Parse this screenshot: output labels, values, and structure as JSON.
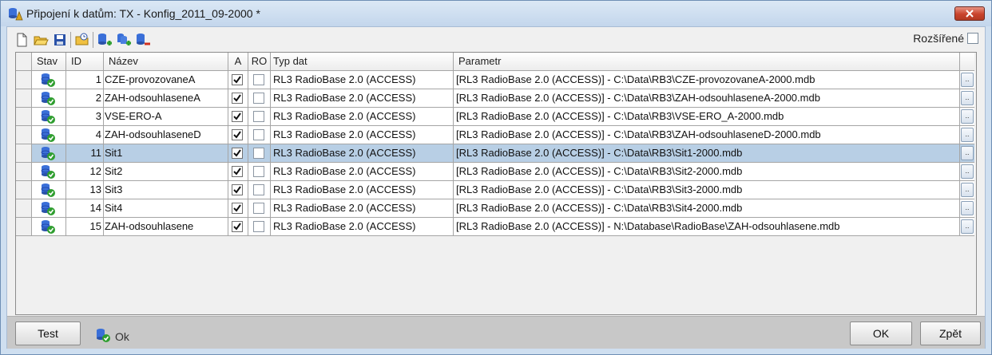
{
  "window": {
    "title": "Připojení k datům: TX - Konfig_2011_09-2000 *",
    "close_icon": "close-icon"
  },
  "toolbar": {
    "icons": [
      "new-document-icon",
      "open-folder-icon",
      "save-icon",
      "open-recent-icon",
      "add-database-icon",
      "add-databases-icon",
      "remove-database-icon"
    ],
    "rozsirene_label": "Rozšířené",
    "rozsirene_checked": false
  },
  "table": {
    "columns": {
      "stav": "Stav",
      "id": "ID",
      "nazev": "Název",
      "a": "A",
      "ro": "RO",
      "typ": "Typ dat",
      "parametr": "Parametr"
    },
    "rows": [
      {
        "id": "1",
        "nazev": "CZE-provozovaneA",
        "a": true,
        "ro": false,
        "typ": "RL3 RadioBase 2.0 (ACCESS)",
        "parametr": "[RL3 RadioBase 2.0 (ACCESS)] - C:\\Data\\RB3\\CZE-provozovaneA-2000.mdb",
        "btn": "..",
        "selected": false
      },
      {
        "id": "2",
        "nazev": "ZAH-odsouhlaseneA",
        "a": true,
        "ro": false,
        "typ": "RL3 RadioBase 2.0 (ACCESS)",
        "parametr": "[RL3 RadioBase 2.0 (ACCESS)] - C:\\Data\\RB3\\ZAH-odsouhlaseneA-2000.mdb",
        "btn": "..",
        "selected": false
      },
      {
        "id": "3",
        "nazev": "VSE-ERO-A",
        "a": true,
        "ro": false,
        "typ": "RL3 RadioBase 2.0 (ACCESS)",
        "parametr": "[RL3 RadioBase 2.0 (ACCESS)] - C:\\Data\\RB3\\VSE-ERO_A-2000.mdb",
        "btn": "..",
        "selected": false
      },
      {
        "id": "4",
        "nazev": "ZAH-odsouhlaseneD",
        "a": true,
        "ro": false,
        "typ": "RL3 RadioBase 2.0 (ACCESS)",
        "parametr": "[RL3 RadioBase 2.0 (ACCESS)] - C:\\Data\\RB3\\ZAH-odsouhlaseneD-2000.mdb",
        "btn": "..",
        "selected": false
      },
      {
        "id": "11",
        "nazev": "Sit1",
        "a": true,
        "ro": false,
        "typ": "RL3 RadioBase 2.0 (ACCESS)",
        "parametr": "[RL3 RadioBase 2.0 (ACCESS)] - C:\\Data\\RB3\\Sit1-2000.mdb",
        "btn": "..",
        "selected": true
      },
      {
        "id": "12",
        "nazev": "Sit2",
        "a": true,
        "ro": false,
        "typ": "RL3 RadioBase 2.0 (ACCESS)",
        "parametr": "[RL3 RadioBase 2.0 (ACCESS)] - C:\\Data\\RB3\\Sit2-2000.mdb",
        "btn": "..",
        "selected": false
      },
      {
        "id": "13",
        "nazev": "Sit3",
        "a": true,
        "ro": false,
        "typ": "RL3 RadioBase 2.0 (ACCESS)",
        "parametr": "[RL3 RadioBase 2.0 (ACCESS)] - C:\\Data\\RB3\\Sit3-2000.mdb",
        "btn": "..",
        "selected": false
      },
      {
        "id": "14",
        "nazev": "Sit4",
        "a": true,
        "ro": false,
        "typ": "RL3 RadioBase 2.0 (ACCESS)",
        "parametr": "[RL3 RadioBase 2.0 (ACCESS)] - C:\\Data\\RB3\\Sit4-2000.mdb",
        "btn": "..",
        "selected": false
      },
      {
        "id": "15",
        "nazev": "ZAH-odsouhlasene",
        "a": true,
        "ro": false,
        "typ": "RL3 RadioBase 2.0 (ACCESS)",
        "parametr": "[RL3 RadioBase 2.0 (ACCESS)] - N:\\Database\\RadioBase\\ZAH-odsouhlasene.mdb",
        "btn": "..",
        "selected": false
      }
    ]
  },
  "footer": {
    "test_label": "Test",
    "status_text": "Ok",
    "ok_label": "OK",
    "back_label": "Zpět"
  },
  "colors": {
    "selected_row": "#b8cfe5",
    "status_ok": "#2f9e2f",
    "db_blue": "#2a5bd7"
  }
}
